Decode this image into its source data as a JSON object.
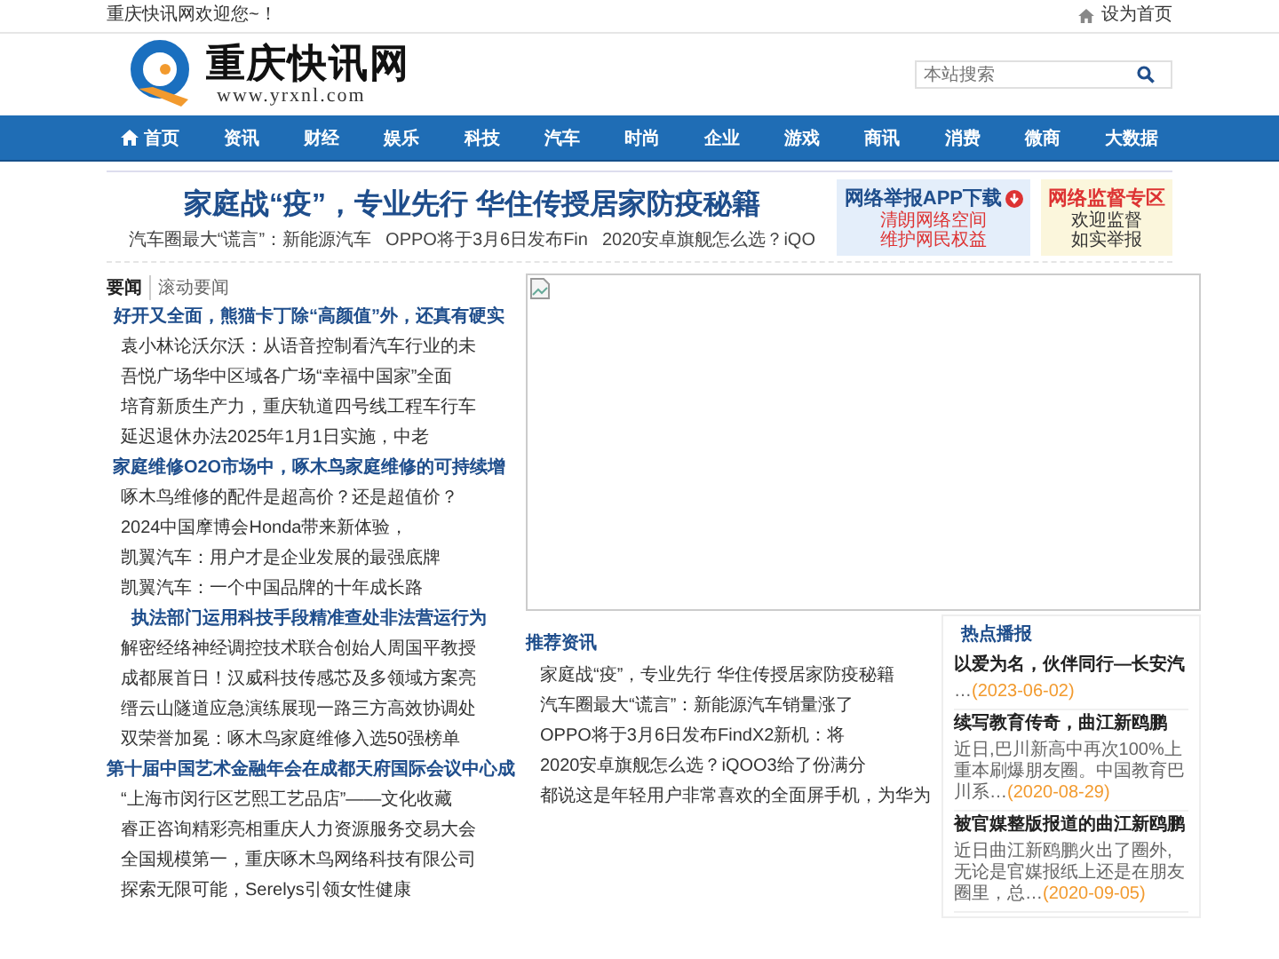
{
  "top_bar": {
    "welcome": "重庆快讯网欢迎您~！",
    "set_home": "设为首页"
  },
  "header": {
    "logo_title": "重庆快讯网",
    "logo_url": "www.yrxnl.com",
    "search": {
      "placeholder": "本站搜索"
    }
  },
  "nav": [
    {
      "label": "首页",
      "kind": "home"
    },
    {
      "label": "资讯",
      "kind": "link"
    },
    {
      "label": "财经",
      "kind": "link"
    },
    {
      "label": "娱乐",
      "kind": "link"
    },
    {
      "label": "科技",
      "kind": "link"
    },
    {
      "label": "汽车",
      "kind": "link"
    },
    {
      "label": "时尚",
      "kind": "link"
    },
    {
      "label": "企业",
      "kind": "link"
    },
    {
      "label": "游戏",
      "kind": "link"
    },
    {
      "label": "商讯",
      "kind": "link"
    },
    {
      "label": "消费",
      "kind": "link"
    },
    {
      "label": "微商",
      "kind": "link"
    },
    {
      "label": "大数据",
      "kind": "link"
    }
  ],
  "headline": {
    "title": "家庭战“疫”，专业先行 华住传授居家防疫秘籍",
    "sub_links": [
      "汽车圈最大“谎言”：新能源汽车",
      "OPPO将于3月6日发布Fin",
      "2020安卓旗舰怎么选？iQO"
    ]
  },
  "badges": [
    {
      "title": "网络举报APP下载",
      "lines": [
        "清朗网络空间",
        "维护网民权益"
      ],
      "kind": "report"
    },
    {
      "title": "网络监督专区",
      "lines": [
        "欢迎监督",
        "如实举报"
      ],
      "kind": "supervise"
    }
  ],
  "news_tabs": [
    {
      "label": "要闻",
      "selected": true
    },
    {
      "label": "滚动要闻",
      "selected": false
    }
  ],
  "news_groups": [
    {
      "heading": "好开又全面，熊猫卡丁除“高颜值”外，还真有硬实",
      "items": [
        "袁小林论沃尔沃：从语音控制看汽车行业的未",
        "吾悦广场华中区域各广场“幸福中国家”全面",
        "培育新质生产力，重庆轨道四号线工程车行车",
        "延迟退休办法2025年1月1日实施，中老"
      ]
    },
    {
      "heading": "家庭维修O2O市场中，啄木鸟家庭维修的可持续增",
      "items": [
        "啄木鸟维修的配件是超高价？还是超值价？",
        "2024中国摩博会Honda带来新体验，",
        "凯翼汽车：用户才是企业发展的最强底牌",
        "凯翼汽车：一个中国品牌的十年成长路"
      ]
    },
    {
      "heading": "执法部门运用科技手段精准查处非法营运行为",
      "items": [
        "解密经络神经调控技术联合创始人周国平教授",
        "成都展首日！汉威科技传感芯及多领域方案亮",
        "缙云山隧道应急演练展现一路三方高效协调处",
        "双荣誉加冕：啄木鸟家庭维修入选50强榜单"
      ]
    },
    {
      "heading": "第十届中国艺术金融年会在成都天府国际会议中心成",
      "items": [
        "“上海市闵行区艺熙工艺品店”——文化收藏",
        "睿正咨询精彩亮相重庆人力资源服务交易大会",
        "全国规模第一，重庆啄木鸟网络科技有限公司",
        "探索无限可能，Serelys引领女性健康"
      ]
    }
  ],
  "recommended": {
    "title": "推荐资讯",
    "items": [
      "家庭战“疫”，专业先行 华住传授居家防疫秘籍",
      "汽车圈最大“谎言”：新能源汽车销量涨了",
      "OPPO将于3月6日发布FindX2新机：将",
      "2020安卓旗舰怎么选？iQOO3给了份满分",
      "都说这是年轻用户非常喜欢的全面屏手机，为华为"
    ]
  },
  "hot": {
    "title": "热点播报",
    "items": [
      {
        "title": "以爱为名，伙伴同行—长安汽",
        "summary": "…",
        "date": "(2023-06-02)"
      },
      {
        "title": "续写教育传奇，曲江新鸥鹏",
        "summary": "近日,巴川新高中再次100%上重本刷爆朋友圈。中国教育巴川系…",
        "date": "(2020-08-29)"
      },
      {
        "title": "被官媒整版报道的曲江新鸥鹏",
        "summary": "近日曲江新鸥鹏火出了圈外,无论是官媒报纸上还是在朋友圈里，总…",
        "date": "(2020-09-05)"
      }
    ]
  }
}
